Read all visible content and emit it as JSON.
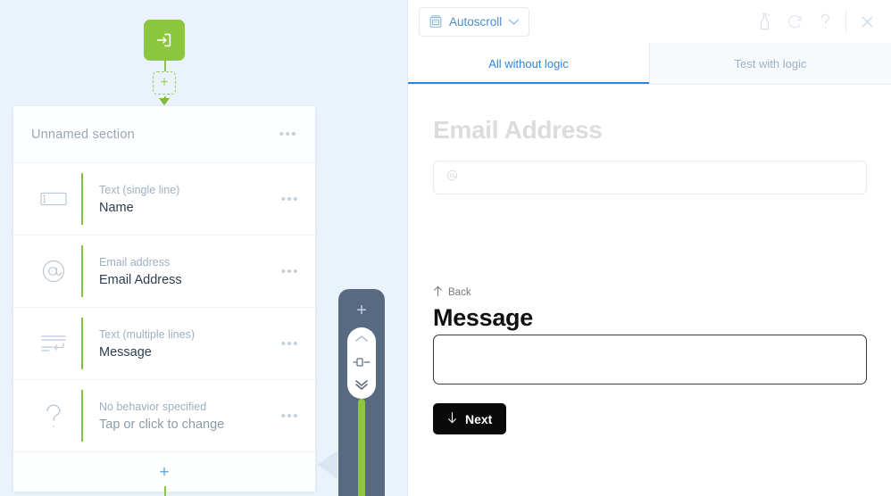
{
  "canvas": {
    "start_node": {
      "icon": "enter-arrow-icon",
      "color": "#8cc63e"
    },
    "add_ghost_label": "+",
    "section": {
      "title": "Unnamed section",
      "menu_label": "•••",
      "fields": [
        {
          "icon": "single-line-text-icon",
          "type": "Text (single line)",
          "label": "Name",
          "menu_label": "•••"
        },
        {
          "icon": "email-at-icon",
          "type": "Email address",
          "label": "Email Address",
          "menu_label": "•••"
        },
        {
          "icon": "multiline-text-icon",
          "type": "Text (multiple lines)",
          "label": "Message",
          "menu_label": "•••"
        },
        {
          "icon": "question-mark-icon",
          "type": "No behavior specified",
          "label": "Tap or click to change",
          "menu_label": "•••"
        }
      ],
      "add_field_label": "+"
    }
  },
  "scroll_widget": {
    "add_label": "+",
    "up_icon": "chevron-up-icon",
    "handle_icon": "drag-handle-icon",
    "down_icon": "chevron-down-icon",
    "track_color": "#8cc63e",
    "background_color": "#586a81"
  },
  "preview": {
    "toolbar": {
      "autoscroll_label": "Autoscroll",
      "autoscroll_icon": "autoscroll-icon",
      "caret_icon": "chevron-down-icon",
      "icons": [
        {
          "name": "test-bottle-icon"
        },
        {
          "name": "refresh-icon"
        },
        {
          "name": "help-question-icon"
        }
      ],
      "close_icon": "close-icon"
    },
    "tabs": [
      {
        "label": "All without logic",
        "active": true
      },
      {
        "label": "Test with logic",
        "active": false
      }
    ],
    "accent_color": "#2e86d6",
    "form": {
      "previous_question_title": "Email Address",
      "previous_input_placeholder_icon": "at-symbol-icon",
      "back_label": "Back",
      "back_icon": "arrow-up-icon",
      "current_question_title": "Message",
      "current_input_value": "",
      "next_label": "Next",
      "next_icon": "arrow-down-icon"
    }
  }
}
